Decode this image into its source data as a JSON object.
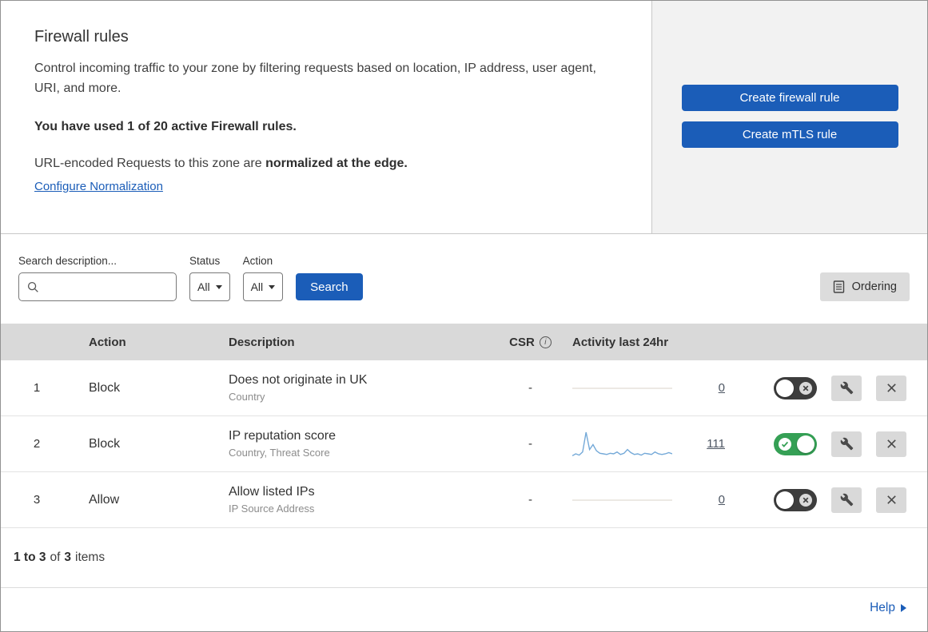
{
  "colors": {
    "accent": "#1b5db8",
    "toggle-on": "#35a055",
    "toggle-off": "#3d3d3d",
    "header-bg": "#d9d9d9",
    "panel": "#f2f2f2",
    "sparkline": "#74a9d8",
    "flatline": "#d9d3ca"
  },
  "icons": {
    "search": "magnifier",
    "info": "i-in-circle",
    "ordering": "document-lines",
    "edit": "wrench",
    "delete": "x",
    "toggle_on": "check-in-circle",
    "toggle_off": "x-in-circle",
    "dropdown_caret": "triangle-down",
    "help_arrow": "triangle-right"
  },
  "header": {
    "title": "Firewall rules",
    "description": "Control incoming traffic to your zone by filtering requests based on location, IP address, user agent, URI, and more.",
    "usage": "You have used 1 of 20 active Firewall rules.",
    "normalization_prefix": "URL-encoded Requests to this zone are ",
    "normalization_bold": "normalized at the edge.",
    "configure_link": "Configure Normalization",
    "buttons": {
      "create_firewall": "Create firewall rule",
      "create_mtls": "Create mTLS rule"
    }
  },
  "filters": {
    "search_label": "Search description...",
    "search_value": "",
    "status_label": "Status",
    "status_value": "All",
    "action_label": "Action",
    "action_value": "All",
    "search_button": "Search",
    "ordering_button": "Ordering"
  },
  "table": {
    "columns": {
      "action": "Action",
      "description": "Description",
      "csr": "CSR",
      "activity": "Activity last 24hr"
    },
    "rows": [
      {
        "index": "1",
        "action": "Block",
        "description": "Does not originate in UK",
        "fields": "Country",
        "csr": "-",
        "activity_count": "0",
        "enabled": false,
        "sparkline": []
      },
      {
        "index": "2",
        "action": "Block",
        "description": "IP reputation score",
        "fields": "Country, Threat Score",
        "csr": "-",
        "activity_count": "111",
        "enabled": true,
        "sparkline": [
          6,
          9,
          7,
          12,
          44,
          16,
          24,
          14,
          10,
          9,
          8,
          10,
          9,
          12,
          8,
          10,
          16,
          11,
          8,
          9,
          7,
          10,
          9,
          8,
          12,
          9,
          8,
          9,
          11,
          9
        ]
      },
      {
        "index": "3",
        "action": "Allow",
        "description": "Allow listed IPs",
        "fields": "IP Source Address",
        "csr": "-",
        "activity_count": "0",
        "enabled": false,
        "sparkline": []
      }
    ]
  },
  "footer": {
    "range": "1 to 3",
    "of": "of",
    "total": "3",
    "items": "items"
  },
  "help": {
    "label": "Help"
  }
}
